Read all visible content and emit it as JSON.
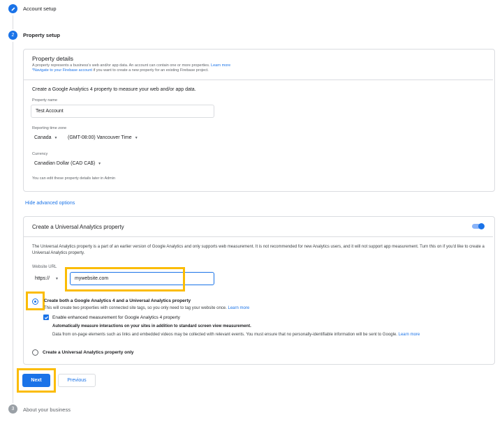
{
  "steps": {
    "account_setup": "Account setup",
    "property_setup": {
      "number": "2",
      "label": "Property setup"
    },
    "about_business": {
      "number": "3",
      "label": "About your business"
    }
  },
  "property_details": {
    "title": "Property details",
    "desc_line1": "A property represents a business's web and/or app data. An account can contain one or more properties.",
    "desc_link": "Learn more",
    "desc_line2_link": "*Navigate to your Firebase account",
    "desc_line2": " if you want to create a new property for an existing Firebase project.",
    "intro": "Create a Google Analytics 4 property to measure your web and/or app data.",
    "property_name_label": "Property name",
    "property_name_value": "Test Account",
    "timezone_label": "Reporting time zone",
    "timezone_country": "Canada",
    "timezone_value": "(GMT-08:00) Vancouver Time",
    "currency_label": "Currency",
    "currency_value": "Canadian Dollar (CAD CA$)",
    "edit_later": "You can edit these property details later in Admin"
  },
  "advanced_link": "Hide advanced options",
  "ua": {
    "title": "Create a Universal Analytics property",
    "toggle_on": true,
    "desc": "The Universal Analytics property is a part of an earlier version of Google Analytics and only supports web measurement. It is not recommended for new Analytics users, and it will not support app measurement. Turn this on if you'd like to create a Universal Analytics property.",
    "website_url_label": "Website URL",
    "protocol": "https://",
    "website_url_value": "mywebsite.com",
    "option_both_label": "Create both a Google Analytics 4 and a Universal Analytics property",
    "option_both_desc": "This will create two properties with connected site tags, so you only need to tag your website once.",
    "option_both_link": "Learn more",
    "enhanced_label": "Enable enhanced measurement for Google Analytics 4 property",
    "enhanced_bold": "Automatically measure interactions on your sites in addition to standard screen view measurement.",
    "enhanced_desc": "Data from on-page elements such as links and embedded videos may be collected with relevant events. You must ensure that no personally-identifiable information will be sent to Google.",
    "enhanced_link": "Learn more",
    "option_ua_only_label": "Create a Universal Analytics property only"
  },
  "buttons": {
    "next": "Next",
    "previous": "Previous"
  },
  "colors": {
    "primary": "#1a73e8",
    "highlight": "#fbbc04",
    "muted": "#9aa0a6"
  }
}
